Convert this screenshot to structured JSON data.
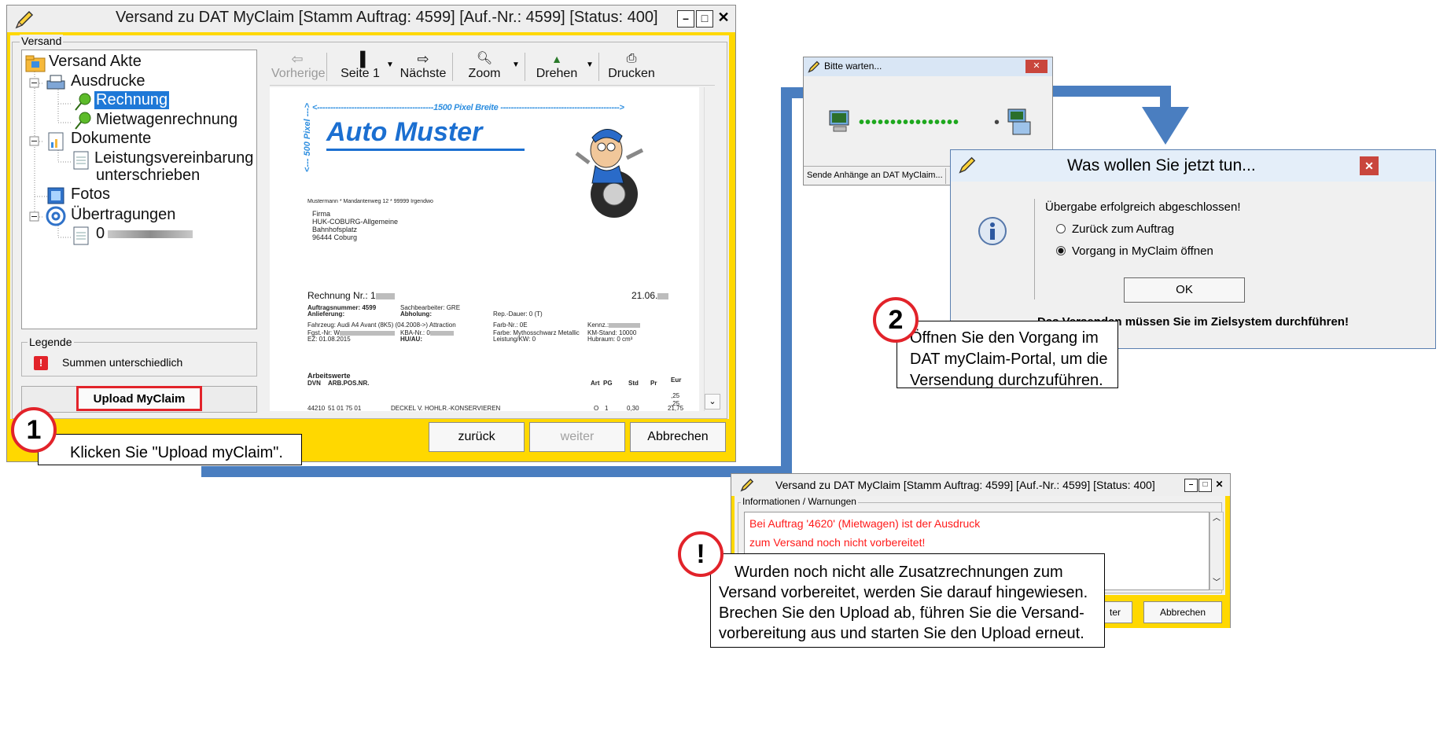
{
  "main_window": {
    "title": "Versand zu DAT MyClaim [Stamm Auftrag: 4599]  [Auf.-Nr.: 4599]  [Status: 400]",
    "group_label": "Versand",
    "tree": {
      "root": "Versand Akte",
      "ausdrucke": "Ausdrucke",
      "rechnung": "Rechnung",
      "mietwagen": "Mietwagenrechnung",
      "dokumente": "Dokumente",
      "leistung1": "Leistungsvereinbarung",
      "leistung2": "unterschrieben",
      "fotos": "Fotos",
      "uebertragungen": "Übertragungen",
      "uebertragung_item": "0"
    },
    "toolbar": {
      "prev": "Vorherige",
      "page": "Seite 1",
      "next": "Nächste",
      "zoom": "Zoom",
      "rotate": "Drehen",
      "print": "Drucken"
    },
    "legend_label": "Legende",
    "legend_item": "Summen unterschiedlich",
    "upload_button": "Upload MyClaim",
    "back_button": "zurück",
    "next_button": "weiter",
    "cancel_button": "Abbrechen"
  },
  "preview": {
    "width_note": "<--------------------------------------------1500 Pixel Breite --------------------------------------------->",
    "height_note": "<--- 500 Pixel --->",
    "company": "Auto Muster",
    "sender_line": "Mustermann * Mandantenweg 12 * 99999 Irgendwo",
    "addr1": "Firma",
    "addr2": "HUK-COBURG-Allgemeine",
    "addr3": "Bahnhofsplatz",
    "addr4": "96444 Coburg",
    "invoice": "Rechnung Nr.: 1",
    "date": "21.06.",
    "f_auftragsnummer": "Auftragsnummer: 4599",
    "f_anlieferung": "Anlieferung:",
    "f_fahrzeug": "Fahrzeug: Audi A4 Avant (8K5) (04.2008->) Attraction",
    "f_fgst": "Fgst.-Nr: W",
    "f_ez": "EZ: 01.08.2015",
    "f_sachbearbeiter": "Sachbearbeiter: GRE",
    "f_abholung": "Abholung:",
    "f_kba": "KBA-Nr.: 0",
    "f_hu": "HU/AU:",
    "f_rep": "Rep.-Dauer: 0 (T)",
    "f_farbnr": "Farb-Nr.: 0E",
    "f_farbe": "Farbe: Mythosschwarz Metallic",
    "f_leistung": "Leistung/KW: 0",
    "f_kennz": "Kennz.:",
    "f_km": "KM-Stand: 10000",
    "f_hubraum": "Hubraum: 0 cm³",
    "arbeitswerte": "Arbeitswerte",
    "col_dvn": "DVN",
    "col_arb": "ARB.POS.NR.",
    "col_art": "Art",
    "col_pg": "PG",
    "col_std": "Std",
    "col_pr": "Pr",
    "col_eur": "Eur",
    "row_dvn": "44210",
    "row_pos": "51 01 75 01",
    "row_desc": "DECKEL V. HOHLR.-KONSERVIEREN",
    "row_art": "O",
    "row_pg": "1",
    "row_std": "0,30",
    "row_eur": "21,75",
    "row_eur_a": ",25",
    "row_eur_b": ",25"
  },
  "wait_window": {
    "title": "Bitte warten...",
    "status": "Sende Anhänge an DAT MyClaim..."
  },
  "dialog": {
    "title": "Was wollen Sie jetzt tun...",
    "message": "Übergabe erfolgreich abgeschlossen!",
    "option1": "Zurück zum Auftrag",
    "option2": "Vorgang in MyClaim öffnen",
    "ok": "OK",
    "footer": "Das Versenden müssen Sie im Zielsystem durchführen!"
  },
  "callouts": {
    "step1_number": "1",
    "step1_text": "Klicken Sie \"Upload myClaim\".",
    "step2_number": "2",
    "step2_text": "Öffnen Sie den Vorgang im DAT myClaim-Portal, um die Versendung durchzuführen.",
    "warn_symbol": "!",
    "warn_text": "Wurden noch nicht alle Zusatzrechnungen zum Versand vorbereitet, werden Sie darauf hingewiesen. Brechen Sie den Upload ab, führen Sie die Versand-vorbereitung aus und starten Sie den Upload erneut."
  },
  "second_window": {
    "title": "Versand zu DAT MyClaim [Stamm Auftrag: 4599]  [Auf.-Nr.: 4599]  [Status: 400]",
    "group_label": "Informationen / Warnungen",
    "line1": "Bei Auftrag '4620' (Mietwagen) ist der Ausdruck",
    "line2": "zum Versand noch nicht vorbereitet!",
    "partial_button": "ter",
    "cancel_button": "Abbrechen"
  },
  "colors": {
    "accent_yellow": "#ffd800",
    "arrow_blue": "#4a7ec0",
    "warn_red": "#e2232a",
    "error_text": "#ff1a1a"
  }
}
